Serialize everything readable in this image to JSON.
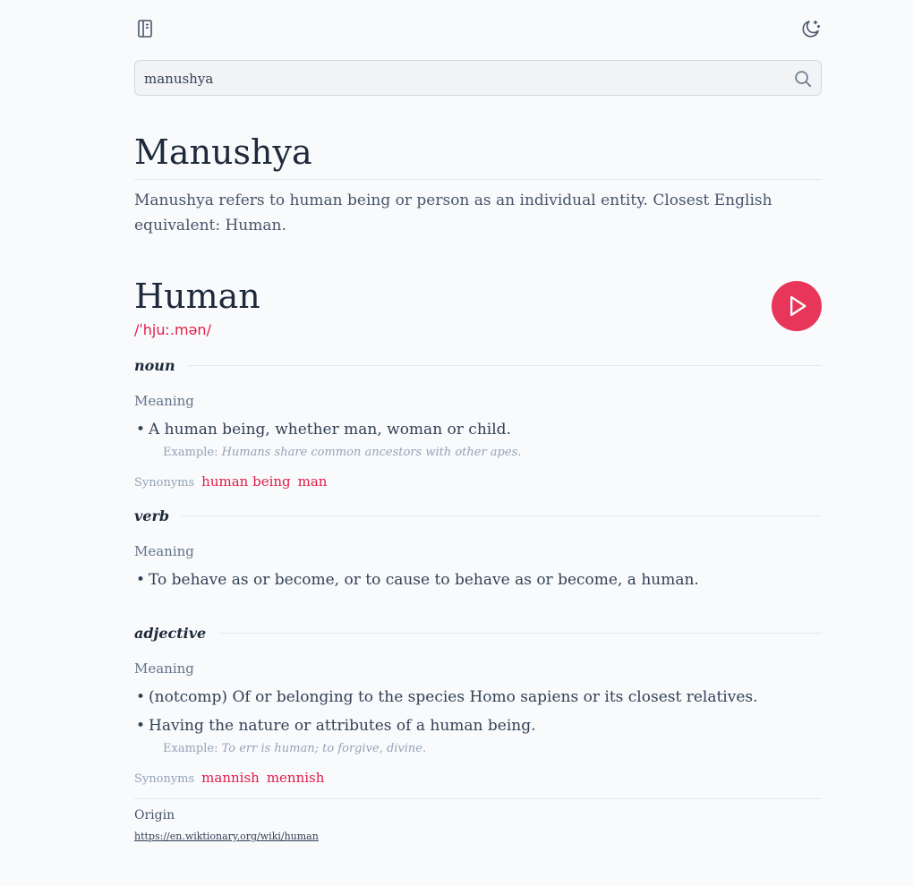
{
  "search": {
    "value": "manushya",
    "placeholder": ""
  },
  "word": {
    "title": "Manushya",
    "description": "Manushya refers to human being or person as an individual entity. Closest English equivalent: Human."
  },
  "entry": {
    "word": "Human",
    "phonetic": "/ˈhjuː.mən/",
    "meanings": [
      {
        "pos": "noun",
        "meaning_label": "Meaning",
        "definitions": [
          {
            "text": "A human being, whether man, woman or child.",
            "example_label": "Example:",
            "example": "Humans share common ancestors with other apes."
          }
        ],
        "synonyms_label": "Synonyms",
        "synonyms": [
          "human being",
          "man"
        ]
      },
      {
        "pos": "verb",
        "meaning_label": "Meaning",
        "definitions": [
          {
            "text": "To behave as or become, or to cause to behave as or become, a human."
          }
        ]
      },
      {
        "pos": "adjective",
        "meaning_label": "Meaning",
        "definitions": [
          {
            "text": "(notcomp) Of or belonging to the species Homo sapiens or its closest relatives."
          },
          {
            "text": "Having the nature or attributes of a human being.",
            "example_label": "Example:",
            "example": "To err is human; to forgive, divine."
          }
        ],
        "synonyms_label": "Synonyms",
        "synonyms": [
          "mannish",
          "mennish"
        ]
      }
    ],
    "origin_label": "Origin",
    "origin_url": "https://en.wiktionary.org/wiki/human"
  },
  "colors": {
    "accent": "#e11d48",
    "play_button": "#e8365a",
    "background": "#f8fafc"
  },
  "icons": {
    "sidebar": "book-icon",
    "theme": "moon-icon",
    "search": "search-icon",
    "play": "play-icon"
  }
}
